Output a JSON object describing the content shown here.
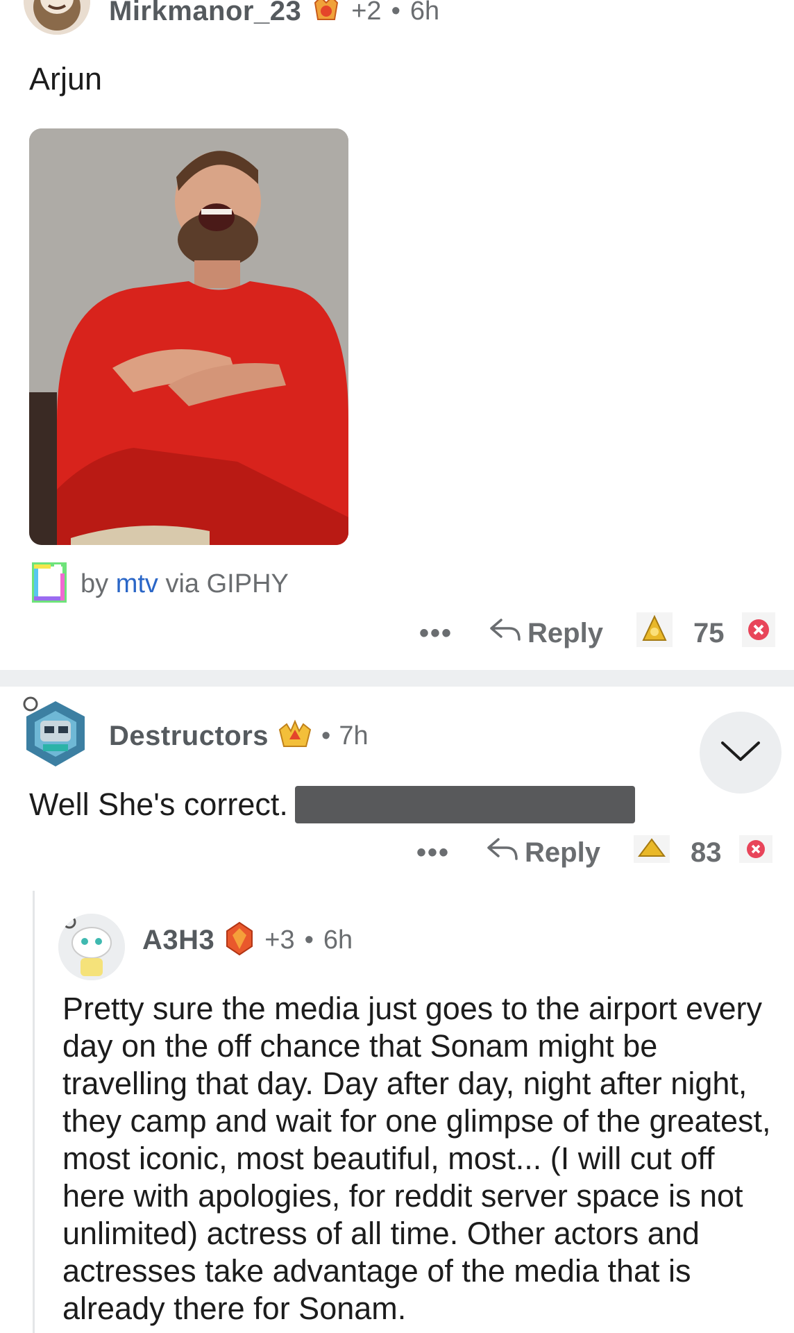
{
  "comments": [
    {
      "username": "Mirkmanor_23",
      "flair_extra": "+2",
      "time": "6h",
      "text": "Arjun",
      "giphy": {
        "by": "by",
        "author": "mtv",
        "via": "via GIPHY"
      },
      "reply_label": "Reply",
      "score": "75",
      "more": "•••"
    },
    {
      "username": "Destructors",
      "time": "7h",
      "text": "Well She's correct.",
      "reply_label": "Reply",
      "score": "83",
      "more": "•••"
    },
    {
      "username": "A3H3",
      "flair_extra": "+3",
      "time": "6h",
      "text": "Pretty sure the media just goes to the airport every day on the off chance that Sonam might be travelling that day. Day after day, night after night, they camp and wait for one glimpse of the greatest, most iconic, most beautiful, most... (I will cut off here with apologies, for reddit server space is not unlimited) actress of all time. Other actors and actresses take advantage of the media that is already there for Sonam."
    }
  ],
  "colors": {
    "link": "#2a66c7",
    "divider": "#edeff1",
    "meta": "#6a6d70",
    "downvote": "#e8455a",
    "upvote_gold": "#e9b829"
  },
  "icons": [
    "collapse-chevron-icon",
    "reply-arrow-icon",
    "upvote-award-icon",
    "downvote-icon",
    "giphy-logo-icon"
  ]
}
